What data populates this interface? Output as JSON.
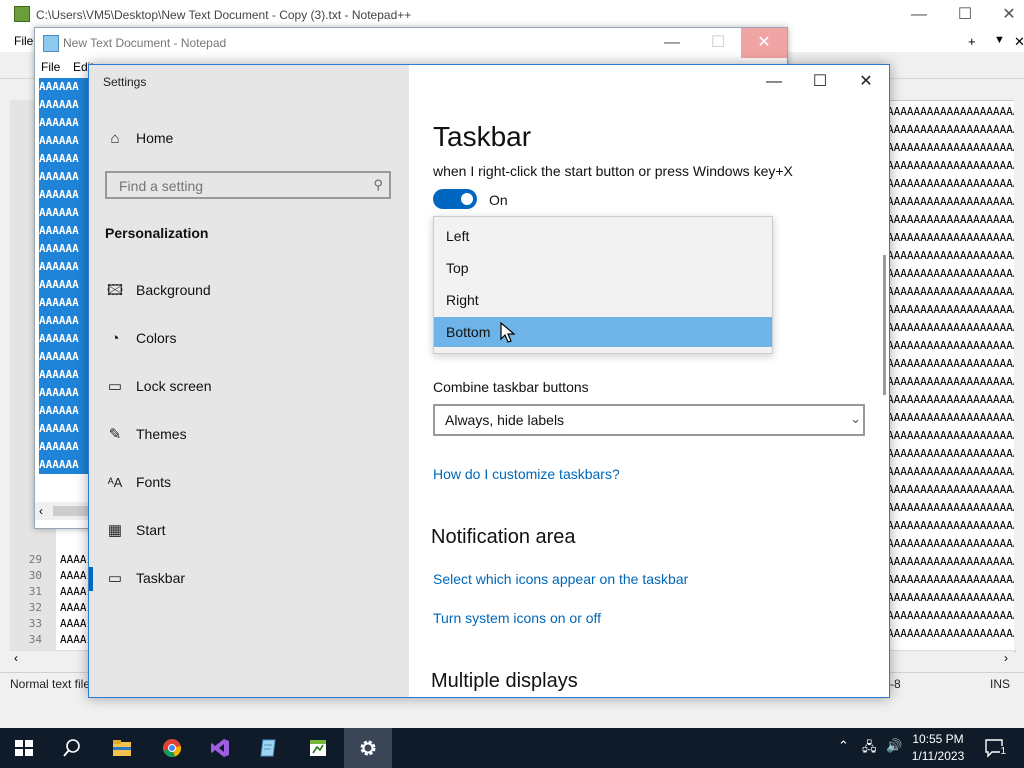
{
  "npp": {
    "title": "C:\\Users\\VM5\\Desktop\\New Text Document - Copy (3).txt - Notepad++",
    "menu_file": "File",
    "status_left": "Normal text file",
    "status_enc": "-8",
    "status_ins": "INS",
    "line_numbers": [
      "29",
      "30",
      "31",
      "32",
      "33",
      "34"
    ],
    "text_fill": "AAAAAAAAAAAAAAAAAAAAAAAAAAAAAAAAAAAAAAAAAAAAAAAAAAAAAAAAAAAAAAAAAAAAAAAAAAAAAAAAAAAAAAAAAAAAAAAAAAAAAAAAAAAAAAAAAAAAAAAAAAA",
    "text_short": "AAAA"
  },
  "notepad": {
    "title": "New Text Document - Notepad",
    "menu": [
      "File",
      "Edit"
    ],
    "selected_text": "AAAAAA"
  },
  "settings": {
    "window_title": "Settings",
    "home": "Home",
    "search_placeholder": "Find a setting",
    "section": "Personalization",
    "nav": [
      {
        "label": "Background",
        "icon": "image-icon"
      },
      {
        "label": "Colors",
        "icon": "palette-icon"
      },
      {
        "label": "Lock screen",
        "icon": "lock-screen-icon"
      },
      {
        "label": "Themes",
        "icon": "brush-icon"
      },
      {
        "label": "Fonts",
        "icon": "font-icon"
      },
      {
        "label": "Start",
        "icon": "start-icon"
      },
      {
        "label": "Taskbar",
        "icon": "taskbar-icon"
      }
    ],
    "selected_nav": "Taskbar",
    "page_title": "Taskbar",
    "toggle_desc": "when I right-click the start button or press Windows key+X",
    "toggle_state": "On",
    "toggle_on": true,
    "dropdown_options": [
      "Left",
      "Top",
      "Right",
      "Bottom"
    ],
    "dropdown_selected": "Bottom",
    "combine_label": "Combine taskbar buttons",
    "combine_value": "Always, hide labels",
    "link_customize": "How do I customize taskbars?",
    "notification_heading": "Notification area",
    "link_icons": "Select which icons appear on the taskbar",
    "link_system_icons": "Turn system icons on or off",
    "multiple_heading": "Multiple displays"
  },
  "taskbar": {
    "time": "10:55 PM",
    "date": "1/11/2023",
    "notification_count": "1",
    "apps": [
      "start-button",
      "search-button",
      "file-explorer",
      "chrome",
      "visual-studio",
      "notepad",
      "notepad-plus-plus",
      "settings"
    ],
    "active_app": "settings"
  },
  "colors": {
    "accent": "#0067c0",
    "link": "#0067b8",
    "selection": "#6eb4e8",
    "taskbar": "#101b2a"
  }
}
